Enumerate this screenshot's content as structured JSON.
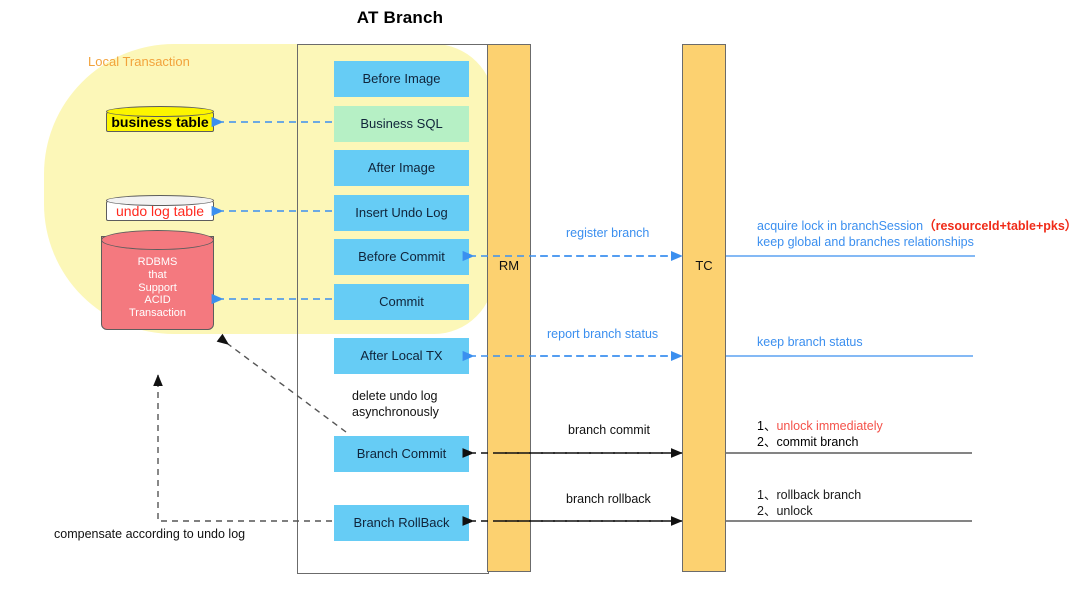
{
  "title": "AT Branch",
  "regions": {
    "local_transaction_label": "Local Transaction",
    "rm_label": "RM",
    "tc_label": "TC"
  },
  "datastores": [
    {
      "name": "business-table",
      "label": "business table"
    },
    {
      "name": "undo-log-table",
      "label": "undo log table"
    },
    {
      "name": "rdbms",
      "label": "RDBMS\nthat\nSupport\nACID\nTransaction",
      "lines": [
        "RDBMS",
        "that",
        "Support",
        "ACID",
        "Transaction"
      ]
    }
  ],
  "steps": [
    {
      "label": "Before Image",
      "color": "blue"
    },
    {
      "label": "Business SQL",
      "color": "green"
    },
    {
      "label": "After Image",
      "color": "blue"
    },
    {
      "label": "Insert Undo Log",
      "color": "blue"
    },
    {
      "label": "Before Commit",
      "color": "blue"
    },
    {
      "label": "Commit",
      "color": "blue"
    },
    {
      "label": "After Local TX",
      "color": "blue"
    },
    {
      "label": "Branch Commit",
      "color": "blue"
    },
    {
      "label": "Branch RollBack",
      "color": "blue"
    }
  ],
  "flows": {
    "register_branch": "register branch",
    "report_branch_status": "report branch status",
    "branch_commit": "branch commit",
    "branch_rollback": "branch rollback"
  },
  "notes": {
    "acquire_lock_line1_a": "acquire lock in branchSession",
    "acquire_lock_line1_b": "（resourceId+table+pks）",
    "acquire_lock_line2": "keep global and branches relationships",
    "keep_branch_status": "keep branch status",
    "commit_1_num": "1、",
    "commit_1_text": "unlock immediately",
    "commit_2_num": "2、",
    "commit_2_text": "commit branch",
    "rollback_1_num": "1、",
    "rollback_1_text": "rollback branch",
    "rollback_2_num": "2、",
    "rollback_2_text": "unlock",
    "delete_undo_log_line1": "delete undo log",
    "delete_undo_log_line2": "asynchronously",
    "compensate": "compensate according to undo log"
  },
  "colors": {
    "step_blue": "#66CCF5",
    "step_green": "#B6F0C5",
    "column_orange": "#FCD170",
    "local_tx_yellow": "#FCF7B8",
    "business_table_yellow": "#FCF500",
    "rdbms_red": "#F4797F",
    "arrow_blue": "#3B8FEF",
    "accent_red": "#F02B18",
    "local_tx_label_orange": "#F2A33C"
  }
}
